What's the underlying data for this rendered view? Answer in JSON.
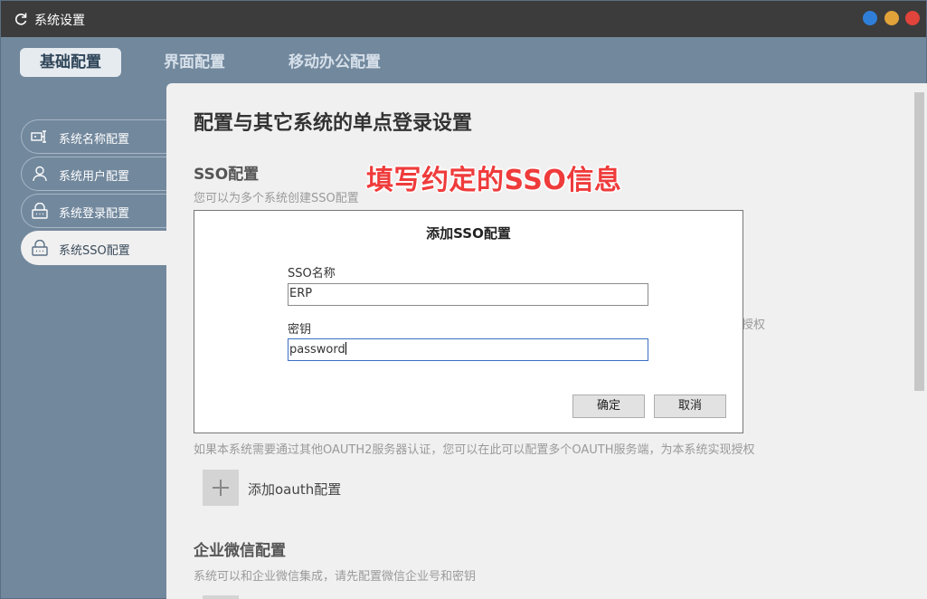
{
  "window": {
    "title": "系统设置"
  },
  "tabs": [
    {
      "label": "基础配置",
      "active": true
    },
    {
      "label": "界面配置",
      "active": false
    },
    {
      "label": "移动办公配置",
      "active": false
    }
  ],
  "sidebar": {
    "items": [
      {
        "label": "系统名称配置",
        "icon": "tag-icon"
      },
      {
        "label": "系统用户配置",
        "icon": "user-icon"
      },
      {
        "label": "系统登录配置",
        "icon": "lock-icon"
      },
      {
        "label": "系统SSO配置",
        "icon": "lock-icon",
        "active": true
      }
    ]
  },
  "main": {
    "page_title": "配置与其它系统的单点登录设置",
    "sso": {
      "title": "SSO配置",
      "desc": "您可以为多个系统创建SSO配置"
    },
    "partial_right_text": "授权",
    "oauth": {
      "desc": "如果本系统需要通过其他OAUTH2服务器认证，您可以在此可以配置多个OAUTH服务端，为本系统实现授权",
      "add_label": "添加oauth配置"
    },
    "wechat": {
      "title": "企业微信配置",
      "desc": "系统可以和企业微信集成，请先配置微信企业号和密钥"
    }
  },
  "annotation": "填写约定的SSO信息",
  "dialog": {
    "title": "添加SSO配置",
    "name_label": "SSO名称",
    "name_value": "ERP",
    "key_label": "密钥",
    "key_value": "password",
    "ok_label": "确定",
    "cancel_label": "取消"
  },
  "colors": {
    "titlebar": "#3c3c3c",
    "sidebar_bg": "#72889d",
    "annotation": "#ef3b3b"
  }
}
